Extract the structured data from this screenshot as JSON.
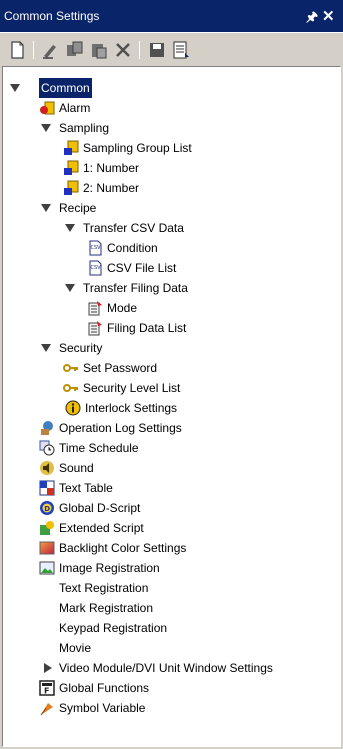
{
  "window": {
    "title": "Common Settings",
    "pin_glyph": "↕",
    "close_glyph": "✕"
  },
  "toolbar": {
    "buttons": [
      "new-icon",
      "edit-icon",
      "copy-icon",
      "paste-icon",
      "delete-icon",
      "save-icon",
      "list-icon"
    ]
  },
  "tree": {
    "common": "Common",
    "alarm": "Alarm",
    "sampling": "Sampling",
    "sampling_group_list": "Sampling Group List",
    "number1": "1: Number",
    "number2": "2: Number",
    "recipe": "Recipe",
    "transfer_csv": "Transfer CSV Data",
    "condition": "Condition",
    "csv_file_list": "CSV File List",
    "transfer_filing": "Transfer Filing Data",
    "mode": "Mode",
    "filing_data_list": "Filing Data List",
    "security": "Security",
    "set_password": "Set Password",
    "security_level_list": "Security Level List",
    "interlock_settings": "Interlock Settings",
    "operation_log": "Operation Log Settings",
    "time_schedule": "Time Schedule",
    "sound": "Sound",
    "text_table": "Text Table",
    "global_dscript": "Global D-Script",
    "extended_script": "Extended Script",
    "backlight": "Backlight Color Settings",
    "image_registration": "Image Registration",
    "text_registration": "Text Registration",
    "mark_registration": "Mark Registration",
    "keypad_registration": "Keypad Registration",
    "movie": "Movie",
    "video_module": "Video Module/DVI Unit Window Settings",
    "global_functions": "Global Functions",
    "symbol_variable": "Symbol Variable"
  }
}
